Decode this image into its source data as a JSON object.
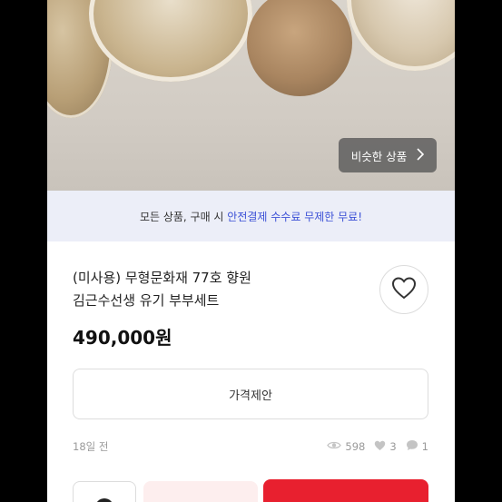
{
  "gallery": {
    "similar_label": "비슷한 상품",
    "chevron_icon": "chevron-right-icon"
  },
  "banner": {
    "text_prefix": "모든 상품, 구매 시 ",
    "text_highlight": "안전결제 수수료 무제한 무료!",
    "highlight_color": "#3b50d6"
  },
  "product": {
    "title_line1": "(미사용) 무형문화재 77호 향원",
    "title_line2": "김근수선생 유기 부부세트",
    "price": "490,000원",
    "like_icon": "heart-outline-icon"
  },
  "actions": {
    "offer_label": "가격제안"
  },
  "meta": {
    "posted": "18일 전",
    "views": "598",
    "likes": "3",
    "chats": "1"
  },
  "colors": {
    "accent_red": "#e8202f",
    "banner_bg": "#eceef8"
  }
}
